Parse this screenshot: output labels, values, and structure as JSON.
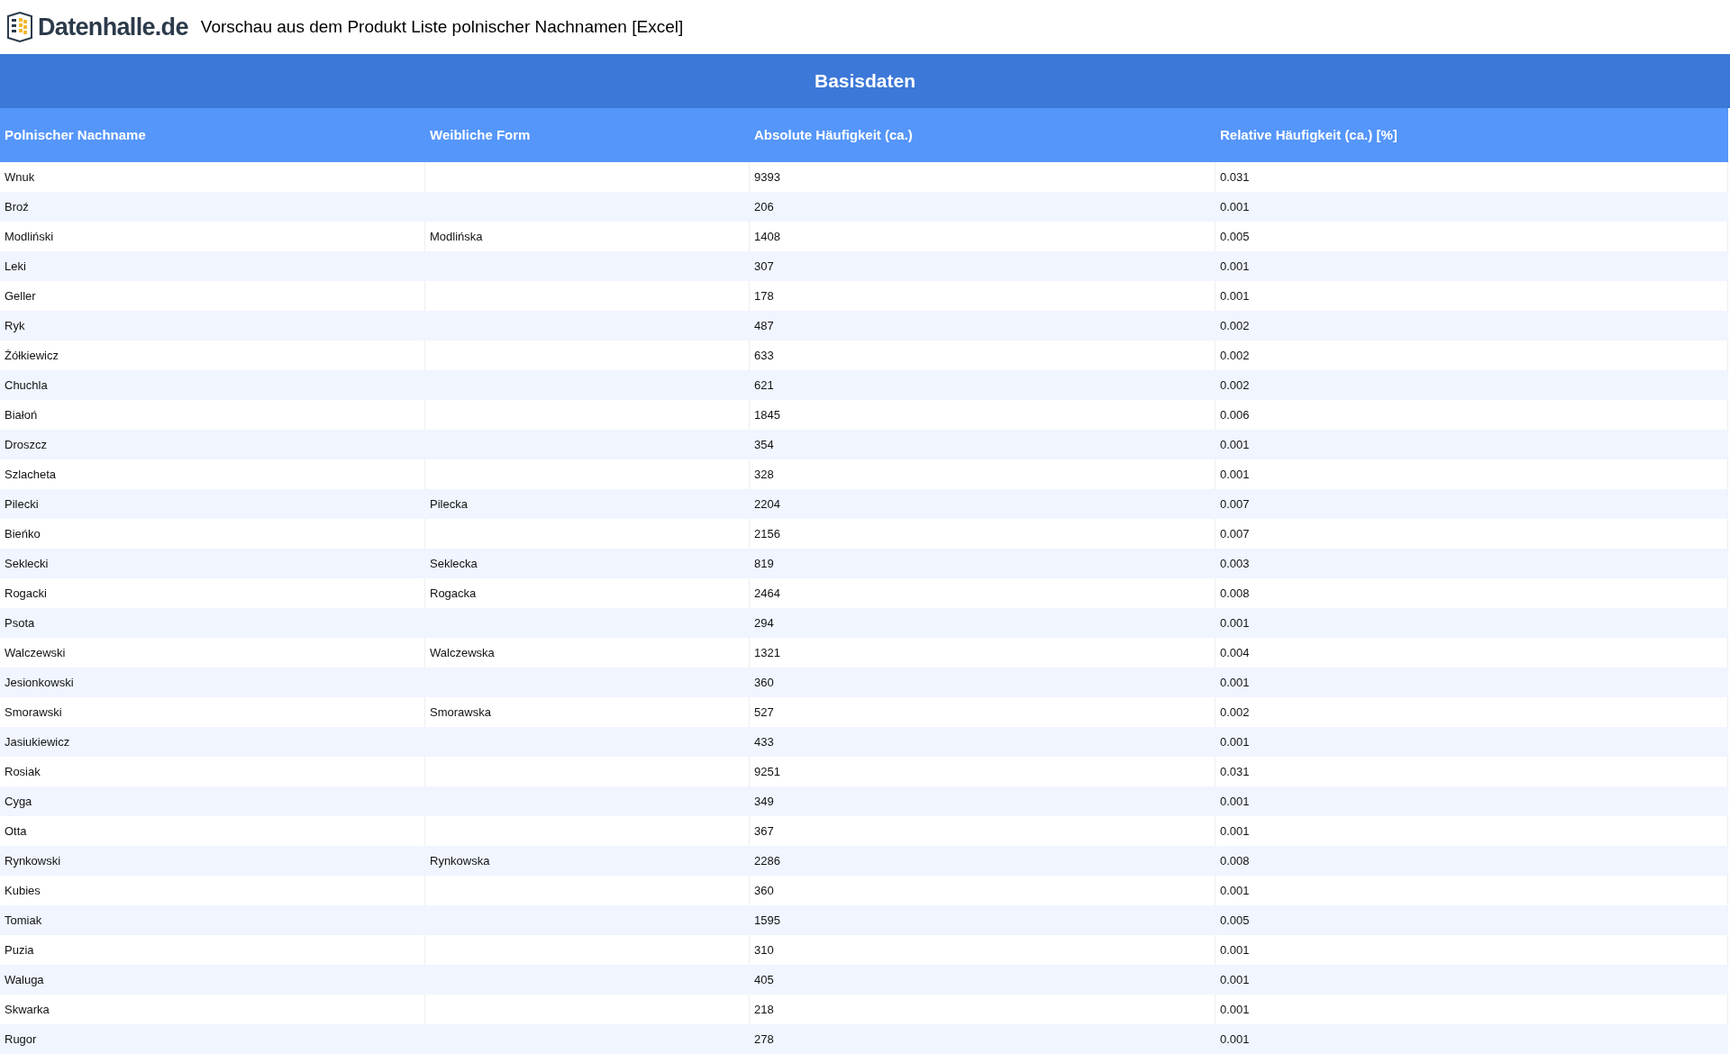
{
  "header": {
    "logo_text": "Datenhalle.de",
    "title": "Vorschau aus dem Produkt Liste polnischer Nachnamen [Excel]"
  },
  "table": {
    "caption": "Basisdaten",
    "columns": [
      "Polnischer Nachname",
      "Weibliche Form",
      "Absolute Häufigkeit (ca.)",
      "Relative Häufigkeit (ca.) [%]"
    ],
    "rows": [
      [
        "Wnuk",
        "",
        "9393",
        "0.031"
      ],
      [
        "Broź",
        "",
        "206",
        "0.001"
      ],
      [
        "Modliński",
        "Modlińska",
        "1408",
        "0.005"
      ],
      [
        "Leki",
        "",
        "307",
        "0.001"
      ],
      [
        "Geller",
        "",
        "178",
        "0.001"
      ],
      [
        "Ryk",
        "",
        "487",
        "0.002"
      ],
      [
        "Żółkiewicz",
        "",
        "633",
        "0.002"
      ],
      [
        "Chuchla",
        "",
        "621",
        "0.002"
      ],
      [
        "Białoń",
        "",
        "1845",
        "0.006"
      ],
      [
        "Droszcz",
        "",
        "354",
        "0.001"
      ],
      [
        "Szlacheta",
        "",
        "328",
        "0.001"
      ],
      [
        "Pilecki",
        "Pilecka",
        "2204",
        "0.007"
      ],
      [
        "Bieńko",
        "",
        "2156",
        "0.007"
      ],
      [
        "Seklecki",
        "Seklecka",
        "819",
        "0.003"
      ],
      [
        "Rogacki",
        "Rogacka",
        "2464",
        "0.008"
      ],
      [
        "Psota",
        "",
        "294",
        "0.001"
      ],
      [
        "Walczewski",
        "Walczewska",
        "1321",
        "0.004"
      ],
      [
        "Jesionkowski",
        "",
        "360",
        "0.001"
      ],
      [
        "Smorawski",
        "Smorawska",
        "527",
        "0.002"
      ],
      [
        "Jasiukiewicz",
        "",
        "433",
        "0.001"
      ],
      [
        "Rosiak",
        "",
        "9251",
        "0.031"
      ],
      [
        "Cyga",
        "",
        "349",
        "0.001"
      ],
      [
        "Otta",
        "",
        "367",
        "0.001"
      ],
      [
        "Rynkowski",
        "Rynkowska",
        "2286",
        "0.008"
      ],
      [
        "Kubies",
        "",
        "360",
        "0.001"
      ],
      [
        "Tomiak",
        "",
        "1595",
        "0.005"
      ],
      [
        "Puzia",
        "",
        "310",
        "0.001"
      ],
      [
        "Waluga",
        "",
        "405",
        "0.001"
      ],
      [
        "Skwarka",
        "",
        "218",
        "0.001"
      ],
      [
        "Rugor",
        "",
        "278",
        "0.001"
      ]
    ]
  }
}
